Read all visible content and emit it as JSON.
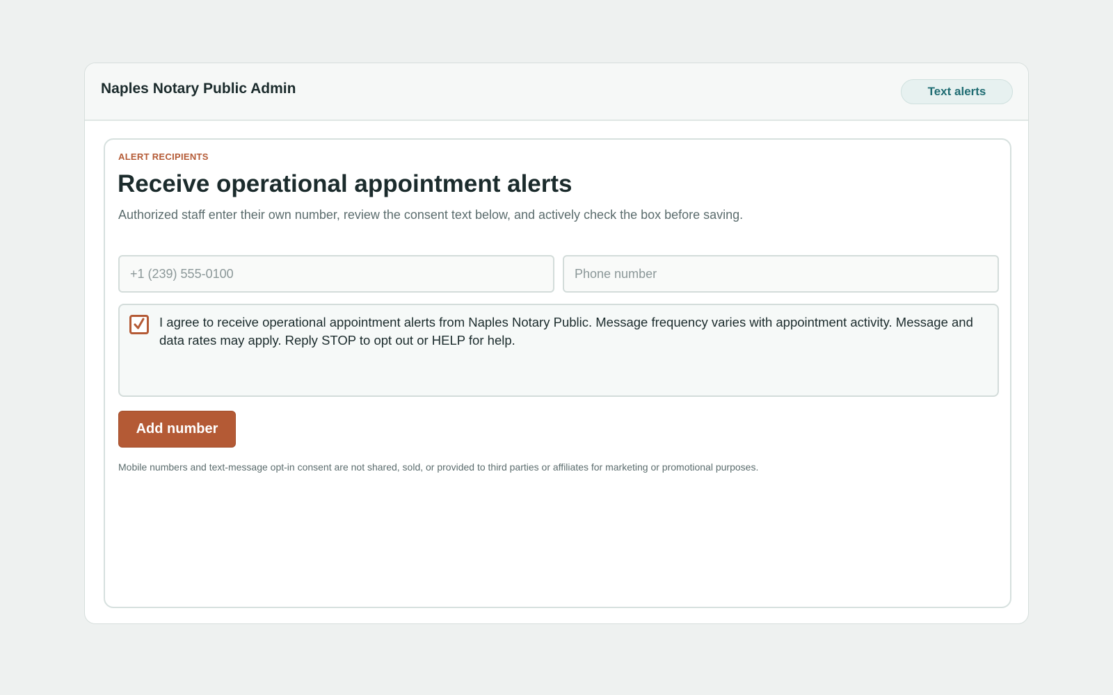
{
  "header": {
    "title": "Naples Notary Public Admin",
    "pill_label": "Text alerts"
  },
  "form": {
    "eyebrow": "ALERT RECIPIENTS",
    "heading": "Receive operational appointment alerts",
    "subtitle": "Authorized staff enter their own number, review the consent text below, and actively check the box before saving.",
    "field_1": {
      "value": "",
      "placeholder": "+1 (239) 555-0100"
    },
    "field_2": {
      "value": "",
      "placeholder": "Phone number"
    },
    "consent": {
      "checked": true,
      "text": "I agree to receive operational appointment alerts from Naples Notary Public. Message frequency varies with appointment activity. Message and data rates may apply. Reply STOP to opt out or HELP for help."
    },
    "submit_label": "Add number",
    "footnote": "Mobile numbers and text-message opt-in consent are not shared, sold, or provided to third parties or affiliates for marketing or promotional purposes."
  },
  "colors": {
    "accent": "#b45a35",
    "teal": "#1f6c72",
    "background": "#eef1f0"
  },
  "icons": {
    "checkbox": "checkmark-icon"
  }
}
